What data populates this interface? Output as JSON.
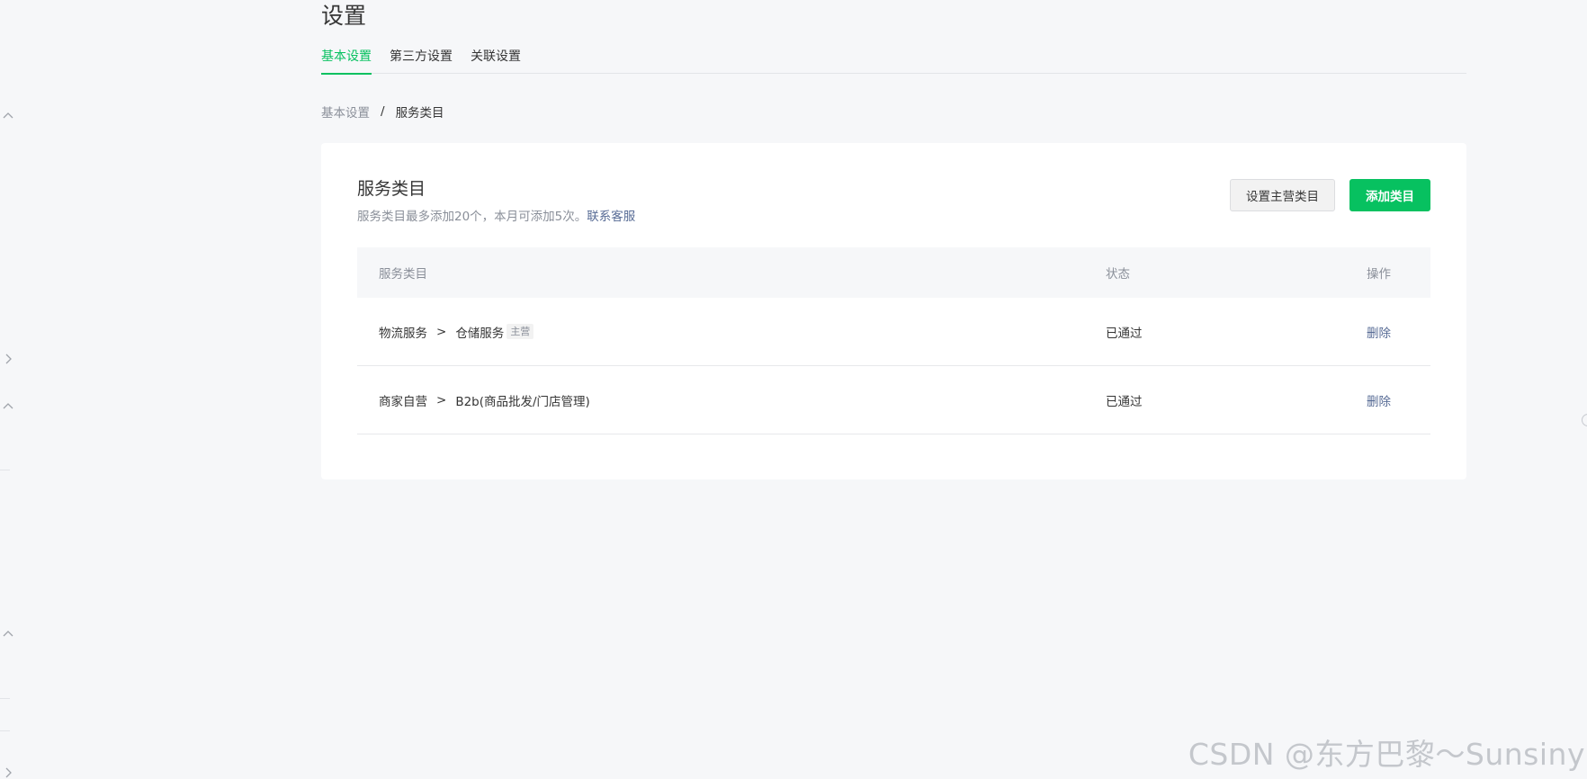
{
  "page": {
    "title": "设置"
  },
  "tabs": [
    {
      "label": "基本设置",
      "active": true
    },
    {
      "label": "第三方设置",
      "active": false
    },
    {
      "label": "关联设置",
      "active": false
    }
  ],
  "breadcrumb": {
    "parent": "基本设置",
    "separator": "/",
    "current": "服务类目"
  },
  "card": {
    "title": "服务类目",
    "desc_text": "服务类目最多添加20个，本月可添加5次。",
    "desc_link": "联系客服",
    "buttons": {
      "set_main": "设置主营类目",
      "add": "添加类目"
    }
  },
  "table": {
    "headers": {
      "name": "服务类目",
      "status": "状态",
      "op": "操作"
    },
    "rows": [
      {
        "category": "物流服务",
        "arrow": ">",
        "subcategory": "仓储服务",
        "tag": "主营",
        "status": "已通过",
        "op": "删除"
      },
      {
        "category": "商家自营",
        "arrow": ">",
        "subcategory": "B2b(商品批发/门店管理)",
        "tag": "",
        "status": "已通过",
        "op": "删除"
      }
    ]
  },
  "watermark": "CSDN @东方巴黎～Sunsiny",
  "colors": {
    "accent": "#07c160",
    "link": "#576b95",
    "muted": "#8a8f99",
    "text": "#353535",
    "background": "#f6f7f9"
  },
  "icons": {
    "sidebar_collapse": "chevron-up-icon",
    "sidebar_expand": "chevron-right-icon"
  }
}
